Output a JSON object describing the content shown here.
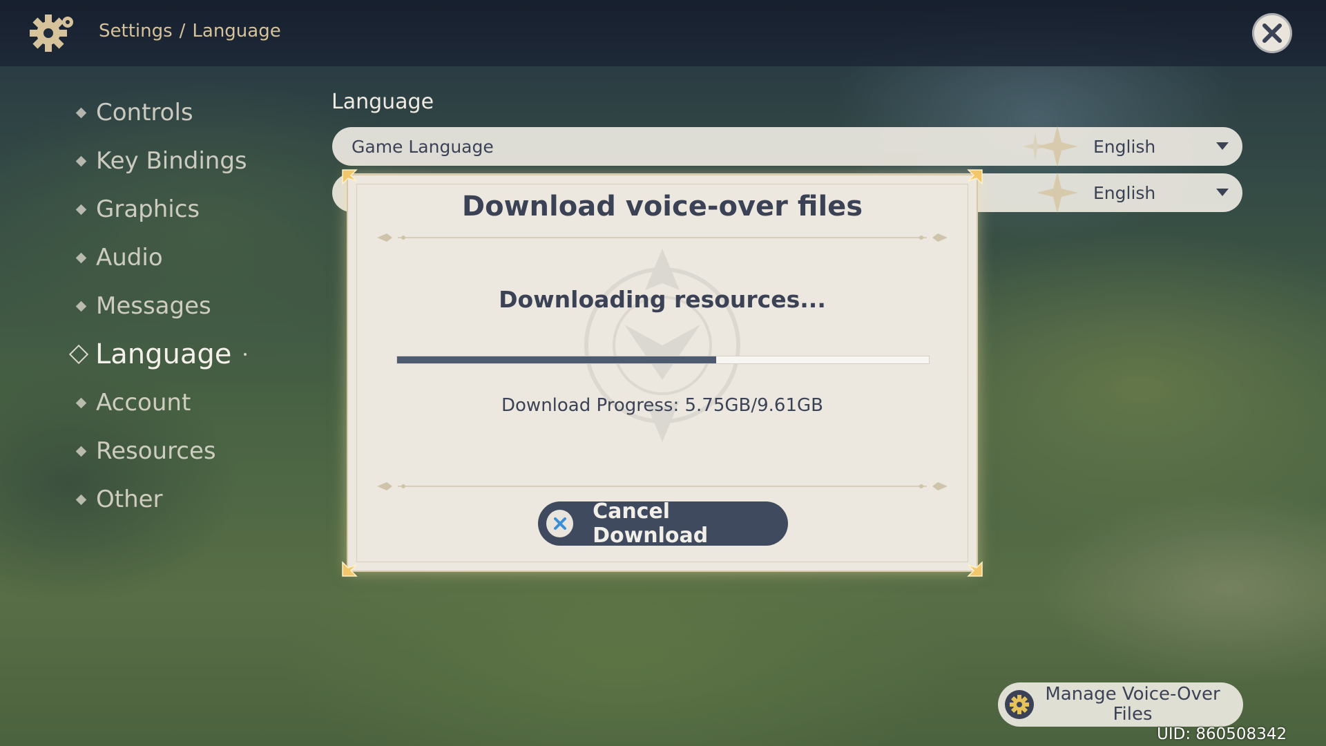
{
  "breadcrumb": {
    "parent": "Settings",
    "separator": "/",
    "current": "Language"
  },
  "sidebar": {
    "items": [
      {
        "label": "Controls",
        "active": false
      },
      {
        "label": "Key Bindings",
        "active": false
      },
      {
        "label": "Graphics",
        "active": false
      },
      {
        "label": "Audio",
        "active": false
      },
      {
        "label": "Messages",
        "active": false
      },
      {
        "label": "Language",
        "active": true
      },
      {
        "label": "Account",
        "active": false
      },
      {
        "label": "Resources",
        "active": false
      },
      {
        "label": "Other",
        "active": false
      }
    ]
  },
  "language_panel": {
    "title": "Language",
    "rows": [
      {
        "label": "Game Language",
        "value": "English"
      },
      {
        "label": "",
        "value": "English"
      }
    ]
  },
  "modal": {
    "title": "Download voice-over files",
    "status": "Downloading resources...",
    "progress_fraction": 0.6,
    "progress_text": "Download Progress: 5.75GB/9.61GB",
    "cancel_label": "Cancel Download"
  },
  "manage_button": {
    "label": "Manage Voice-Over Files"
  },
  "uid": "UID: 860508342",
  "colors": {
    "accent_dark": "#3b4255",
    "progress_fill": "#4e5a6f",
    "breadcrumb": "#d6c29b",
    "x_icon_blue": "#3a8fd8"
  },
  "icons": [
    "gear-icon",
    "close-icon",
    "diamond-bullet-icon",
    "x-circle-icon",
    "chevron-down-icon"
  ]
}
